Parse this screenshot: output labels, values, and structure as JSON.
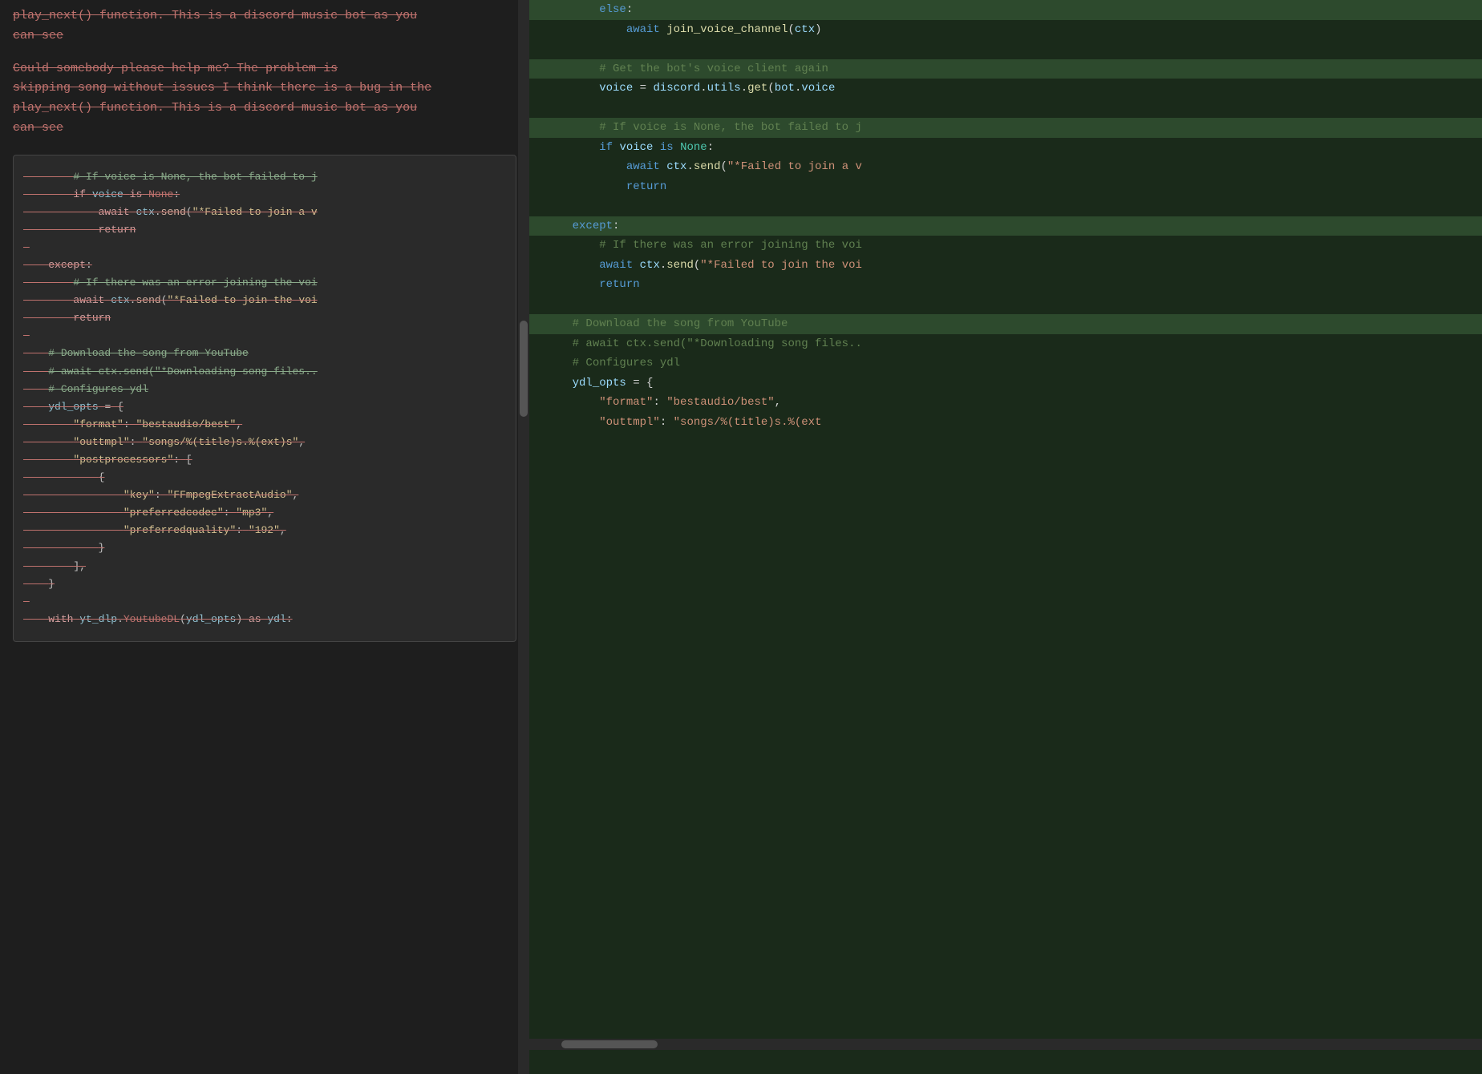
{
  "left": {
    "intro_strikethrough_1": "play_next() function. This is a discord music bot as you",
    "intro_strikethrough_2": "can see",
    "para_strikethrough": "Could somebody please help me? The problem is skipping song without issues I think there is a bug in the play_next() function. This is a discord music bot as you can see",
    "code_lines_left": [
      "        # If voice is None, the bot failed to j",
      "        if voice is None:",
      "            await ctx.send(\"*Failed to join a v",
      "            return",
      "",
      "    except:",
      "        # If there was an error joining the voi",
      "        await ctx.send(\"*Failed to join the voi",
      "        return",
      "",
      "    # Download the song from YouTube",
      "    # await ctx.send(\"*Downloading song files..",
      "    # Configures ydl",
      "    ydl_opts = {",
      "        \"format\": \"bestaudio/best\",",
      "        \"outtmpl\": \"songs/%(title)s.%(ext)s\",",
      "        \"postprocessors\": [",
      "            {",
      "                \"key\": \"FFmpegExtractAudio\",",
      "                \"preferredcodec\": \"mp3\",",
      "                \"preferredquality\": \"192\",",
      "            }",
      "        ],",
      "    }",
      "",
      "    with yt_dlp.YoutubeDL(ydl_opts) as ydl:"
    ]
  },
  "right": {
    "code_lines": [
      {
        "text": "        else:",
        "highlight": true
      },
      {
        "text": "            await join_voice_channel(ctx)",
        "highlight": false
      },
      {
        "text": "",
        "highlight": false
      },
      {
        "text": "        # Get the bot's voice client again",
        "highlight": true
      },
      {
        "text": "        voice = discord.utils.get(bot.voice",
        "highlight": false
      },
      {
        "text": "",
        "highlight": false
      },
      {
        "text": "        # If voice is None, the bot failed to j",
        "highlight": true
      },
      {
        "text": "        if voice is None:",
        "highlight": false
      },
      {
        "text": "            await ctx.send(\"*Failed to join a v",
        "highlight": false
      },
      {
        "text": "            return",
        "highlight": false
      },
      {
        "text": "",
        "highlight": false
      },
      {
        "text": "    except:",
        "highlight": true
      },
      {
        "text": "        # If there was an error joining the voi",
        "highlight": false
      },
      {
        "text": "        await ctx.send(\"*Failed to join the voi",
        "highlight": false
      },
      {
        "text": "        return",
        "highlight": false
      },
      {
        "text": "",
        "highlight": false
      },
      {
        "text": "    # Download the song from YouTube",
        "highlight": true
      },
      {
        "text": "    # await ctx.send(\"*Downloading song files..",
        "highlight": false
      },
      {
        "text": "    # Configures ydl",
        "highlight": false
      },
      {
        "text": "    ydl_opts = {",
        "highlight": false
      },
      {
        "text": "        \"format\": \"bestaudio/best\",",
        "highlight": false
      },
      {
        "text": "        \"outtmpl\": \"songs/%(title)s.%(ext",
        "highlight": false
      }
    ]
  }
}
